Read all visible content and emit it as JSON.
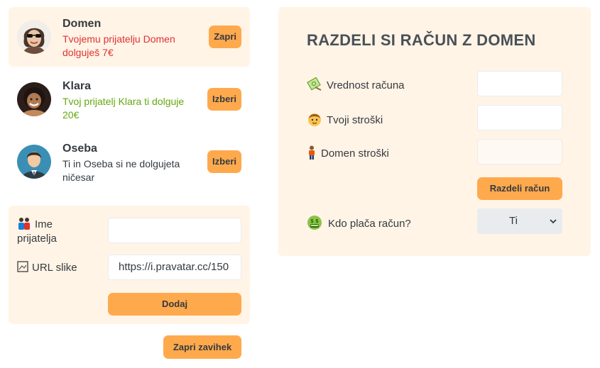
{
  "friends": [
    {
      "name": "Domen",
      "status": "Tvojemu prijatelju Domen dolguješ 7€",
      "button": "Zapri"
    },
    {
      "name": "Klara",
      "status": "Tvoj prijatelj Klara ti dolguje 20€",
      "button": "Izberi"
    },
    {
      "name": "Oseba",
      "status": "Ti in Oseba si ne dolgujeta ničesar",
      "button": "Izberi"
    }
  ],
  "add_friend": {
    "name_label": "Ime prijatelja",
    "name_value": "",
    "url_label": "URL slike",
    "url_value": "https://i.pravatar.cc/150",
    "submit": "Dodaj"
  },
  "close_form_button": "Zapri zavihek",
  "split": {
    "title": "RAZDELI SI RAČUN Z DOMEN",
    "bill_label": "Vrednost računa",
    "bill_value": "",
    "my_expense_label": "Tvoji stroški",
    "my_expense_value": "",
    "friend_expense_label": "Domen stroški",
    "friend_expense_value": "",
    "payer_label": "Kdo plača račun?",
    "payer_value": "Ti",
    "submit": "Razdeli račun"
  },
  "colors": {
    "accent": "#ffa94d",
    "panel": "#fff4e6",
    "owe": "#e03131",
    "owed": "#66a80f"
  }
}
